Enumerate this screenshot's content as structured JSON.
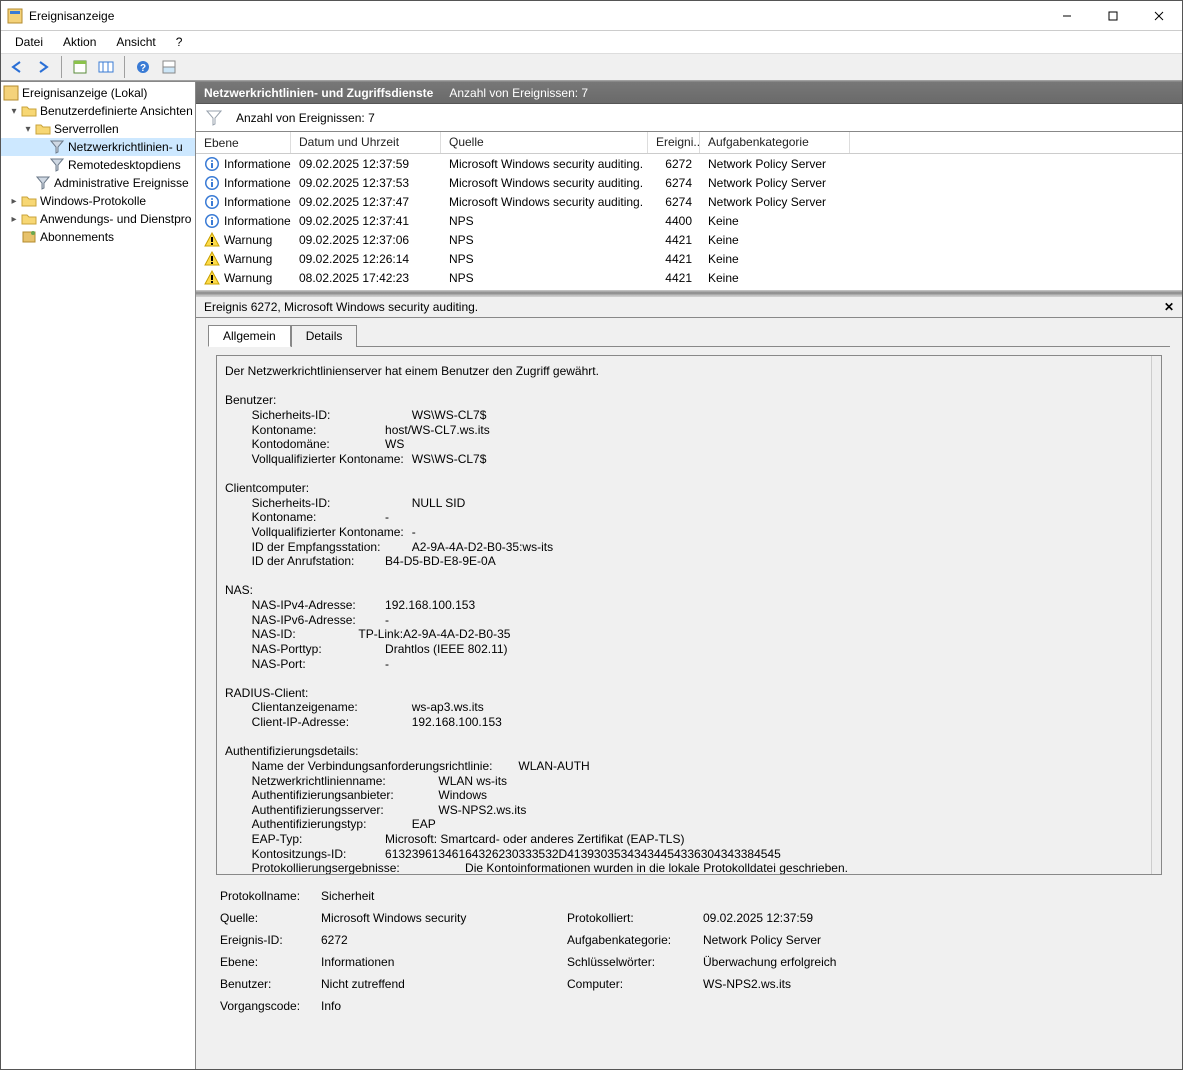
{
  "window": {
    "title": "Ereignisanzeige"
  },
  "menus": {
    "file": "Datei",
    "action": "Aktion",
    "view": "Ansicht",
    "help": "?"
  },
  "tree": {
    "root": "Ereignisanzeige (Lokal)",
    "custom_views": "Benutzerdefinierte Ansichten",
    "server_roles": "Serverrollen",
    "nps": "Netzwerkrichtlinien- u",
    "rds": "Remotedesktopdiens",
    "admin": "Administrative Ereignisse",
    "winlogs": "Windows-Protokolle",
    "appservices": "Anwendungs- und Dienstpro",
    "subs": "Abonnements"
  },
  "header": {
    "title": "Netzwerkrichtlinien- und Zugriffsdienste",
    "sub": "Anzahl von Ereignissen: 7"
  },
  "filter": {
    "text": "Anzahl von Ereignissen: 7"
  },
  "columns": {
    "ebene": "Ebene",
    "datum": "Datum und Uhrzeit",
    "quelle": "Quelle",
    "id": "Ereigni...",
    "kat": "Aufgabenkategorie"
  },
  "rows": [
    {
      "level": "Informationen",
      "icon": "info",
      "date": "09.02.2025 12:37:59",
      "source": "Microsoft Windows security auditing.",
      "id": "6272",
      "cat": "Network Policy Server"
    },
    {
      "level": "Informationen",
      "icon": "info",
      "date": "09.02.2025 12:37:53",
      "source": "Microsoft Windows security auditing.",
      "id": "6274",
      "cat": "Network Policy Server"
    },
    {
      "level": "Informationen",
      "icon": "info",
      "date": "09.02.2025 12:37:47",
      "source": "Microsoft Windows security auditing.",
      "id": "6274",
      "cat": "Network Policy Server"
    },
    {
      "level": "Informationen",
      "icon": "info",
      "date": "09.02.2025 12:37:41",
      "source": "NPS",
      "id": "4400",
      "cat": "Keine"
    },
    {
      "level": "Warnung",
      "icon": "warn",
      "date": "09.02.2025 12:37:06",
      "source": "NPS",
      "id": "4421",
      "cat": "Keine"
    },
    {
      "level": "Warnung",
      "icon": "warn",
      "date": "09.02.2025 12:26:14",
      "source": "NPS",
      "id": "4421",
      "cat": "Keine"
    },
    {
      "level": "Warnung",
      "icon": "warn",
      "date": "08.02.2025 17:42:23",
      "source": "NPS",
      "id": "4421",
      "cat": "Keine"
    }
  ],
  "detail_header": "Ereignis 6272, Microsoft Windows security auditing.",
  "tabs": {
    "general": "Allgemein",
    "details": "Details"
  },
  "message": "Der Netzwerkrichtlinienserver hat einem Benutzer den Zugriff gewährt.\n\nBenutzer:\n\tSicherheits-ID:\t\t\tWS\\WS-CL7$\n\tKontoname:\t\t\thost/WS-CL7.ws.its\n\tKontodomäne:\t\t\tWS\n\tVollqualifizierter Kontoname:\tWS\\WS-CL7$\n\nClientcomputer:\n\tSicherheits-ID:\t\t\tNULL SID\n\tKontoname:\t\t\t-\n\tVollqualifizierter Kontoname:\t-\n\tID der Empfangsstation:\t\tA2-9A-4A-D2-B0-35:ws-its\n\tID der Anrufstation:\t\tB4-D5-BD-E8-9E-0A\n\nNAS:\n\tNAS-IPv4-Adresse:\t\t192.168.100.153\n\tNAS-IPv6-Adresse:\t\t-\n\tNAS-ID:\t\t\tTP-Link:A2-9A-4A-D2-B0-35\n\tNAS-Porttyp:\t\t\tDrahtlos (IEEE 802.11)\n\tNAS-Port:\t\t\t-\n\nRADIUS-Client:\n\tClientanzeigename:\t\tws-ap3.ws.its\n\tClient-IP-Adresse:\t\t\t192.168.100.153\n\nAuthentifizierungsdetails:\n\tName der Verbindungsanforderungsrichtlinie:\tWLAN-AUTH\n\tNetzwerkrichtlinienname:\t\tWLAN ws-its\n\tAuthentifizierungsanbieter:\t\tWindows\n\tAuthentifizierungsserver:\t\tWS-NPS2.ws.its\n\tAuthentifizierungstyp:\t\tEAP\n\tEAP-Typ:\t\t\t\tMicrosoft: Smartcard- oder anderes Zertifikat (EAP-TLS)\n\tKontositzungs-ID:\t\t61323961346164326230333532D41393035343434454336304343384545\n\tProtokollierungsergebnisse:\t\t\tDie Kontoinformationen wurden in die lokale Protokolldatei geschrieben.",
  "meta": {
    "labels": {
      "logname": "Protokollname:",
      "source": "Quelle:",
      "logged": "Protokolliert:",
      "eventid": "Ereignis-ID:",
      "taskcat": "Aufgabenkategorie:",
      "level": "Ebene:",
      "keywords": "Schlüsselwörter:",
      "user": "Benutzer:",
      "computer": "Computer:",
      "opcode": "Vorgangscode:"
    },
    "values": {
      "logname": "Sicherheit",
      "source": "Microsoft Windows security",
      "logged": "09.02.2025 12:37:59",
      "eventid": "6272",
      "taskcat": "Network Policy Server",
      "level": "Informationen",
      "keywords": "Überwachung erfolgreich",
      "user": "Nicht zutreffend",
      "computer": "WS-NPS2.ws.its",
      "opcode": "Info"
    }
  }
}
